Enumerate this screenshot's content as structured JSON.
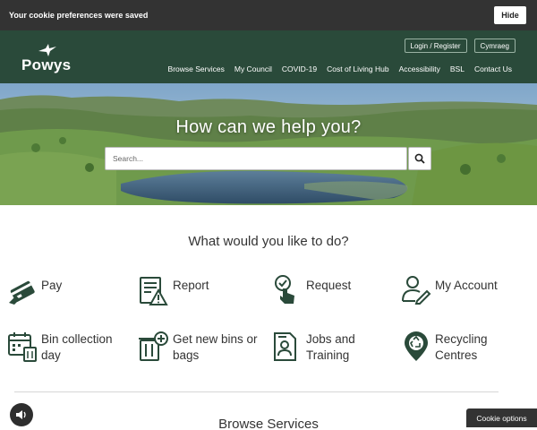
{
  "cookie_banner": {
    "message": "Your cookie preferences were saved",
    "hide_label": "Hide"
  },
  "header": {
    "logo_text": "Powys",
    "top_buttons": [
      "Login / Register",
      "Cymraeg"
    ],
    "nav": [
      "Browse Services",
      "My Council",
      "COVID-19",
      "Cost of Living Hub",
      "Accessibility",
      "BSL",
      "Contact Us"
    ]
  },
  "hero": {
    "title": "How can we help you?",
    "search_placeholder": "Search..."
  },
  "main": {
    "title": "What would you like to do?",
    "tiles": [
      {
        "label": "Pay",
        "icon": "card-payment-icon"
      },
      {
        "label": "Report",
        "icon": "report-document-icon"
      },
      {
        "label": "Request",
        "icon": "tap-checkmark-icon"
      },
      {
        "label": "My Account",
        "icon": "user-account-icon"
      },
      {
        "label": "Bin collection day",
        "icon": "calendar-bin-icon"
      },
      {
        "label": "Get new bins or bags",
        "icon": "add-bin-icon"
      },
      {
        "label": "Jobs and Training",
        "icon": "job-document-icon"
      },
      {
        "label": "Recycling Centres",
        "icon": "recycling-location-icon"
      }
    ],
    "browse_title": "Browse Services"
  },
  "footer_controls": {
    "cookie_options_label": "Cookie options",
    "audio_icon": "speaker-icon"
  },
  "colors": {
    "header_bg": "#2a4a3a",
    "icon_green": "#2a4a3a",
    "cookie_bar_bg": "#333333"
  }
}
